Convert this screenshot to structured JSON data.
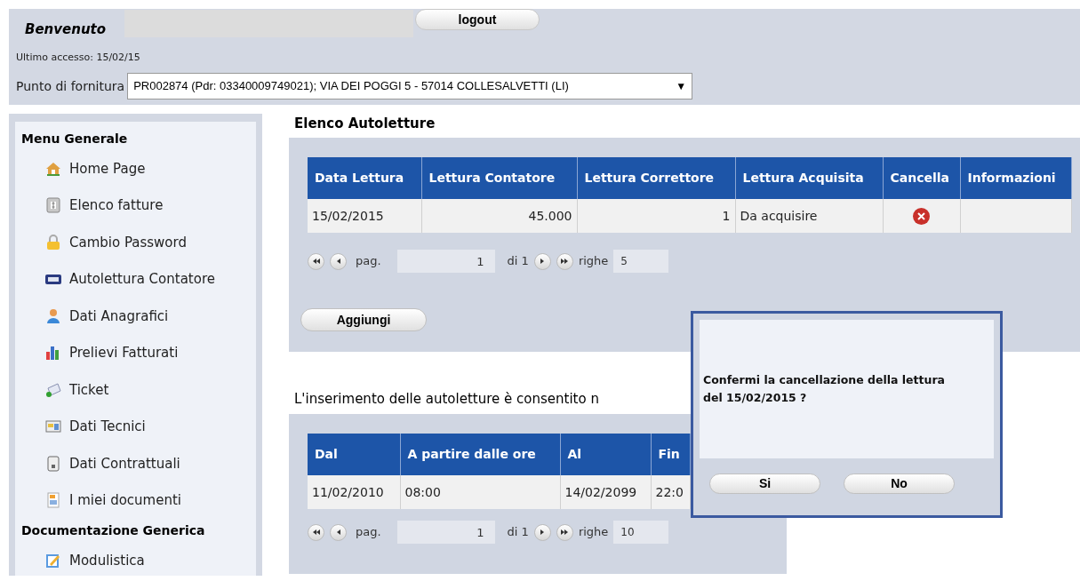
{
  "header": {
    "welcome": "Benvenuto",
    "logout": "logout",
    "last_access": "Ultimo accesso: 15/02/15",
    "supply_label": "Punto di fornitura",
    "supply_value": "PR002874 (Pdr: 03340009749021); VIA DEI POGGI 5 - 57014 COLLESALVETTI (LI)",
    "dropdown_arrow": "▼"
  },
  "sidebar": {
    "sections": [
      {
        "title": "Menu Generale",
        "items": [
          {
            "label": "Home Page",
            "kind": "home"
          },
          {
            "label": "Elenco fatture",
            "kind": "invoice"
          },
          {
            "label": "Cambio Password",
            "kind": "lock"
          },
          {
            "label": "Autolettura Contatore",
            "kind": "meter"
          },
          {
            "label": "Dati Anagrafici",
            "kind": "user"
          },
          {
            "label": "Prelievi Fatturati",
            "kind": "chart"
          },
          {
            "label": "Ticket",
            "kind": "ticket"
          },
          {
            "label": "Dati Tecnici",
            "kind": "tech"
          },
          {
            "label": "Dati Contrattuali",
            "kind": "doc"
          },
          {
            "label": "I miei documenti",
            "kind": "docs"
          }
        ]
      },
      {
        "title": "Documentazione Generica",
        "items": [
          {
            "label": "Modulistica",
            "kind": "edit"
          }
        ]
      }
    ]
  },
  "readings": {
    "title": "Elenco Autoletture",
    "table": {
      "columns": [
        "Data Lettura",
        "Lettura Contatore",
        "Lettura Correttore",
        "Lettura Acquisita",
        "Cancella",
        "Informazioni"
      ],
      "rows": [
        {
          "cells": [
            "15/02/2015",
            "45.000",
            "1",
            "Da acquisire",
            "",
            ""
          ]
        }
      ]
    },
    "pager": {
      "page_label": "pag.",
      "page": "1",
      "of": "di 1",
      "rows_label": "righe",
      "rows": "5"
    },
    "add_button": "Aggiungi"
  },
  "windows": {
    "title": "L'inserimento delle autoletture è consentito n",
    "table": {
      "columns": [
        "Dal",
        "A partire dalle ore",
        "Al",
        "Fin"
      ],
      "rows": [
        {
          "cells": [
            "11/02/2010",
            "08:00",
            "14/02/2099",
            "22:0"
          ]
        }
      ]
    },
    "pager": {
      "page_label": "pag.",
      "page": "1",
      "of": "di 1",
      "rows_label": "righe",
      "rows": "10"
    }
  },
  "dialog": {
    "message": "Confermi la cancellazione della lettura del 15/02/2015 ?",
    "buttons": [
      "Si",
      "No"
    ]
  }
}
